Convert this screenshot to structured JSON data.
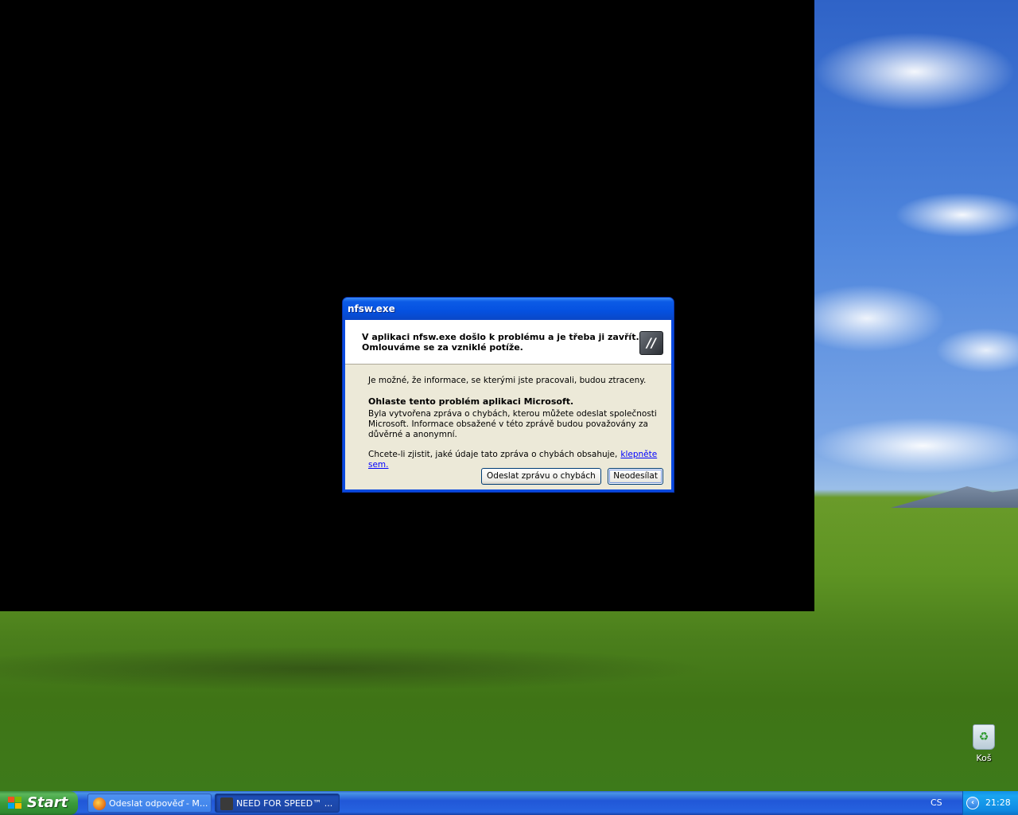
{
  "dialog": {
    "title": "nfsw.exe",
    "header_line1": "V aplikaci nfsw.exe došlo k problému a je třeba ji zavřít.",
    "header_line2": "Omlouváme se za vzniklé potíže.",
    "info": "Je možné, že informace, se kterými jste pracovali, budou ztraceny.",
    "report_heading": "Ohlaste tento problém aplikaci Microsoft.",
    "report_text": "Byla vytvořena zpráva o chybách, kterou můžete odeslat společnosti Microsoft. Informace obsažené v této zprávě budou považovány za důvěrné a anonymní.",
    "details_prompt": "Chcete-li zjistit, jaké údaje tato zpráva o chybách obsahuje,",
    "details_link": "klepněte sem.",
    "send_button": "Odeslat zprávu o chybách",
    "dont_send_button": "Neodesílat",
    "app_icon": "need-for-speed-icon"
  },
  "desktop": {
    "recycle_bin_label": "Koš"
  },
  "taskbar": {
    "start_label": "Start",
    "tasks": [
      {
        "label": "Odeslat odpověď - M...",
        "icon": "firefox-icon",
        "color": "#e87a1d"
      },
      {
        "label": "NEED FOR SPEED™ ...",
        "icon": "need-for-speed-icon",
        "color": "#3a3a3a"
      }
    ],
    "language": "CS",
    "clock": "21:28"
  },
  "colors": {
    "titlebar": "#0551e0",
    "dialog_bg": "#ece9d8",
    "link": "#0000ff",
    "taskbar": "#2157d7",
    "start": "#3b9b3b",
    "tray": "#0f8ae3"
  }
}
